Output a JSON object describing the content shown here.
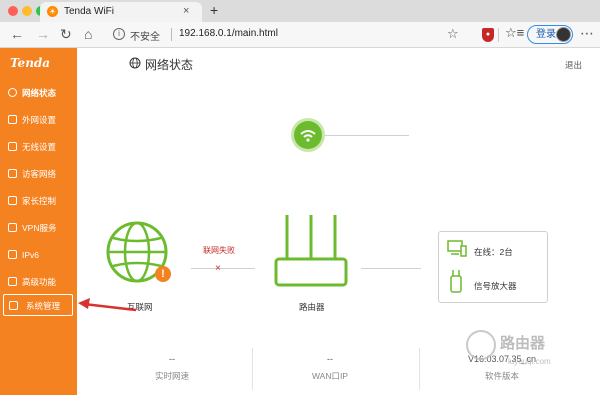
{
  "browser": {
    "tab_title": "Tenda WiFi",
    "tab_close": "×",
    "new_tab": "+",
    "nav_back": "←",
    "nav_forward": "→",
    "nav_reload": "↻",
    "nav_home": "⌂",
    "security_label": "不安全",
    "url": "192.168.0.1/main.html",
    "bookmark": "☆",
    "favorites": "☆≡",
    "login_label": "登录",
    "more": "⋯"
  },
  "sidebar": {
    "logo": "Tenda",
    "items": [
      {
        "label": "网络状态",
        "active": true
      },
      {
        "label": "外网设置"
      },
      {
        "label": "无线设置"
      },
      {
        "label": "访客网络"
      },
      {
        "label": "家长控制"
      },
      {
        "label": "VPN服务"
      },
      {
        "label": "IPv6"
      },
      {
        "label": "高级功能"
      },
      {
        "label": "系统管理",
        "highlighted": true
      }
    ]
  },
  "header": {
    "title": "网络状态",
    "logout": "退出"
  },
  "diagram": {
    "internet_label": "互联网",
    "connection_status": "联网失败",
    "fail_mark": "×",
    "router_label": "路由器",
    "online_devices": "在线：2台",
    "extender": "信号放大器",
    "warning": "!"
  },
  "stats": [
    {
      "label": "实时网速",
      "value": "--"
    },
    {
      "label": "WAN口IP",
      "value": "--"
    },
    {
      "label": "软件版本",
      "value": "V16.03.07.35_cn"
    }
  ],
  "watermark": {
    "text": "路由器",
    "sub": "luyouqi.com"
  },
  "colors": {
    "brand_orange": "#f58220",
    "wifi_green": "#6cbb2f",
    "error_red": "#c62828"
  }
}
